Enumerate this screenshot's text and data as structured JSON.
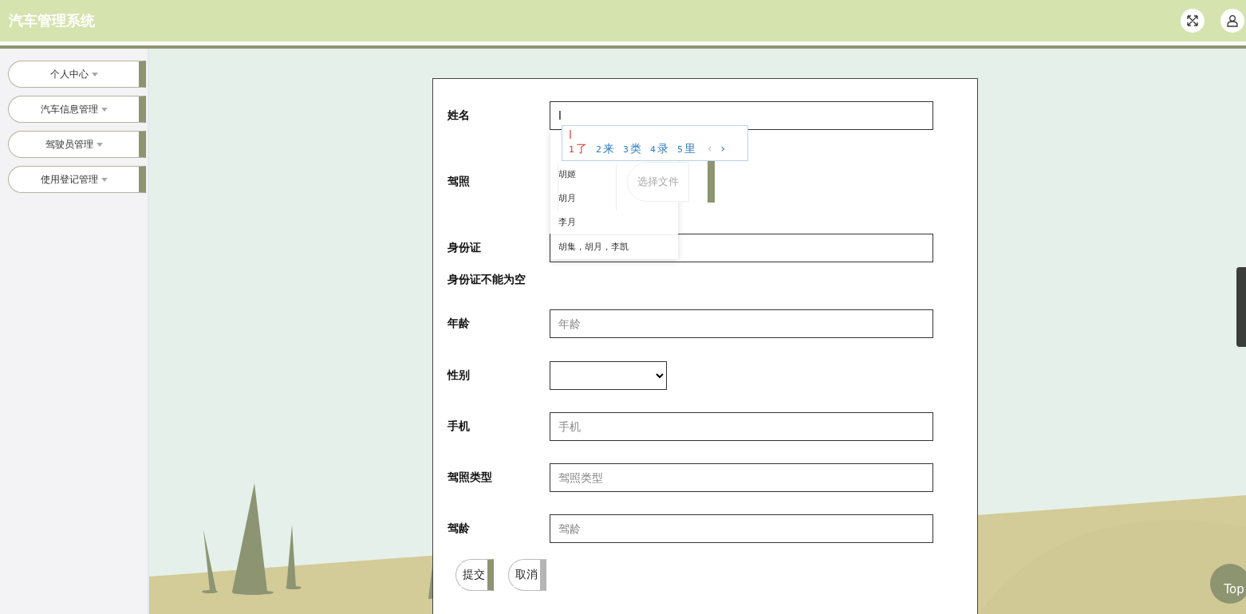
{
  "header": {
    "title": "汽车管理系统"
  },
  "sidebar": {
    "items": [
      {
        "label": "个人中心",
        "expanded": false
      },
      {
        "label": "汽车信息管理",
        "expanded": false
      },
      {
        "label": "驾驶员管理",
        "expanded": false
      },
      {
        "label": "使用登记管理",
        "expanded": false
      }
    ]
  },
  "form": {
    "fields": [
      {
        "kind": "text",
        "label": "姓名",
        "value": "l"
      },
      {
        "kind": "file",
        "label": "驾照",
        "button": "选择文件"
      },
      {
        "kind": "text",
        "label": "身份证",
        "error": "身份证不能为空"
      },
      {
        "kind": "text",
        "label": "年龄",
        "placeholder": "年龄"
      },
      {
        "kind": "select",
        "label": "性别"
      },
      {
        "kind": "text",
        "label": "手机",
        "placeholder": "手机"
      },
      {
        "kind": "text",
        "label": "驾照类型",
        "placeholder": "驾照类型"
      },
      {
        "kind": "text",
        "label": "驾龄",
        "placeholder": "驾龄"
      }
    ],
    "buttons": [
      {
        "label": "提交",
        "kind": "primary"
      },
      {
        "label": "取消",
        "kind": "secondary"
      }
    ]
  },
  "autocomplete": {
    "items": [
      "胡姬",
      "胡月",
      "李月",
      "胡集，胡月，李凯"
    ]
  },
  "ime": {
    "composition": "l",
    "candidates": [
      {
        "index": "1",
        "text": "了",
        "selected": true
      },
      {
        "index": "2",
        "text": "来",
        "selected": false
      },
      {
        "index": "3",
        "text": "类",
        "selected": false
      },
      {
        "index": "4",
        "text": "录",
        "selected": false
      },
      {
        "index": "5",
        "text": "里",
        "selected": false
      }
    ],
    "prev": "‹",
    "next": "›"
  },
  "back_to_top": {
    "label": "Top"
  }
}
